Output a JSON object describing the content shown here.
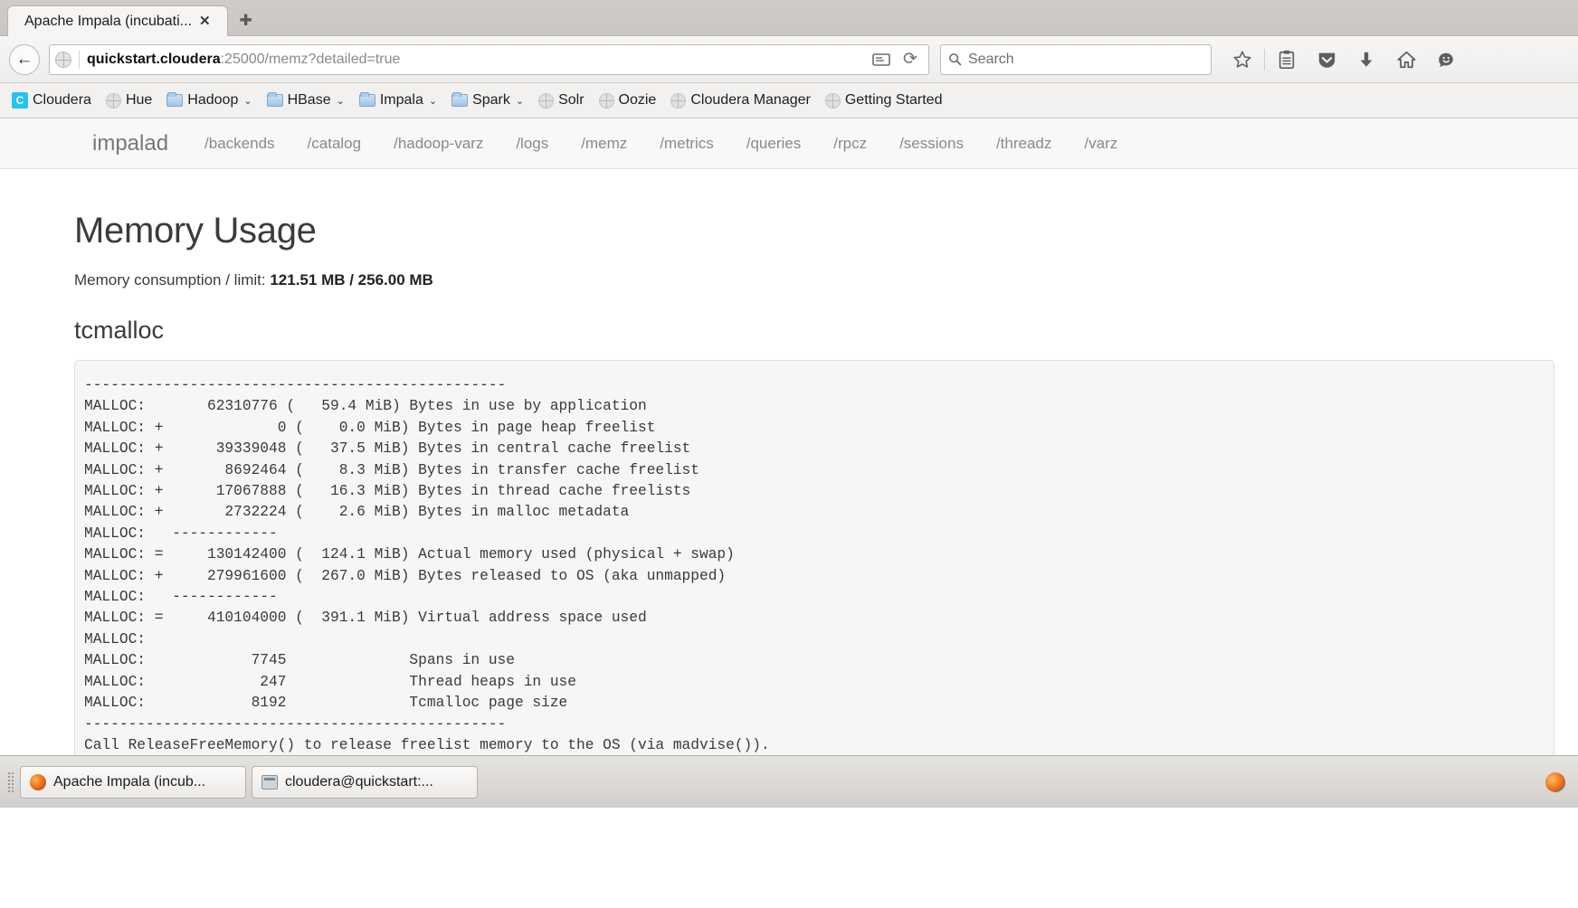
{
  "browser": {
    "tab": {
      "title": "Apache Impala (incubati...",
      "close_label": "✕"
    },
    "new_tab_label": "✚",
    "back_label": "←",
    "url": {
      "host": "quickstart.cloudera",
      "rest": ":25000/memz?detailed=true"
    },
    "search_placeholder": "Search",
    "reload_label": "⟳",
    "reader_label": "☰",
    "toolbar_icons": [
      "bookmark-star-icon",
      "library-icon",
      "pocket-icon",
      "downloads-icon",
      "home-icon",
      "sync-smiley-icon"
    ]
  },
  "bookmarks": [
    {
      "label": "Cloudera",
      "icon": "cloudera-logo-icon",
      "caret": false
    },
    {
      "label": "Hue",
      "icon": "globe-icon",
      "caret": false
    },
    {
      "label": "Hadoop",
      "icon": "folder-icon",
      "caret": true
    },
    {
      "label": "HBase",
      "icon": "folder-icon",
      "caret": true
    },
    {
      "label": "Impala",
      "icon": "folder-icon",
      "caret": true
    },
    {
      "label": "Spark",
      "icon": "folder-icon",
      "caret": true
    },
    {
      "label": "Solr",
      "icon": "globe-icon",
      "caret": false
    },
    {
      "label": "Oozie",
      "icon": "globe-icon",
      "caret": false
    },
    {
      "label": "Cloudera Manager",
      "icon": "globe-icon",
      "caret": false
    },
    {
      "label": "Getting Started",
      "icon": "globe-icon",
      "caret": false
    }
  ],
  "impala_nav": {
    "brand": "impalad",
    "links": [
      "/backends",
      "/catalog",
      "/hadoop-varz",
      "/logs",
      "/memz",
      "/metrics",
      "/queries",
      "/rpcz",
      "/sessions",
      "/threadz",
      "/varz"
    ]
  },
  "main": {
    "title": "Memory Usage",
    "consumption_label": "Memory consumption / limit: ",
    "consumption_value": "121.51 MB / 256.00 MB",
    "section_title": "tcmalloc",
    "tcmalloc_output": "------------------------------------------------\nMALLOC:       62310776 (   59.4 MiB) Bytes in use by application\nMALLOC: +             0 (    0.0 MiB) Bytes in page heap freelist\nMALLOC: +      39339048 (   37.5 MiB) Bytes in central cache freelist\nMALLOC: +       8692464 (    8.3 MiB) Bytes in transfer cache freelist\nMALLOC: +      17067888 (   16.3 MiB) Bytes in thread cache freelists\nMALLOC: +       2732224 (    2.6 MiB) Bytes in malloc metadata\nMALLOC:   ------------\nMALLOC: =     130142400 (  124.1 MiB) Actual memory used (physical + swap)\nMALLOC: +     279961600 (  267.0 MiB) Bytes released to OS (aka unmapped)\nMALLOC:   ------------\nMALLOC: =     410104000 (  391.1 MiB) Virtual address space used\nMALLOC:\nMALLOC:            7745              Spans in use\nMALLOC:             247              Thread heaps in use\nMALLOC:            8192              Tcmalloc page size\n------------------------------------------------\nCall ReleaseFreeMemory() to release freelist memory to the OS (via madvise()).\nBytes released to the OS take up virtual address space but no physical memory."
  },
  "taskbar": {
    "items": [
      {
        "label": "Apache Impala (incub...",
        "icon": "firefox-icon"
      },
      {
        "label": "cloudera@quickstart:...",
        "icon": "terminal-icon"
      }
    ]
  },
  "colors": {
    "accent": "#27c3ec",
    "code_bg": "#f6f6f6",
    "nav_bg": "#f8f8f8"
  }
}
